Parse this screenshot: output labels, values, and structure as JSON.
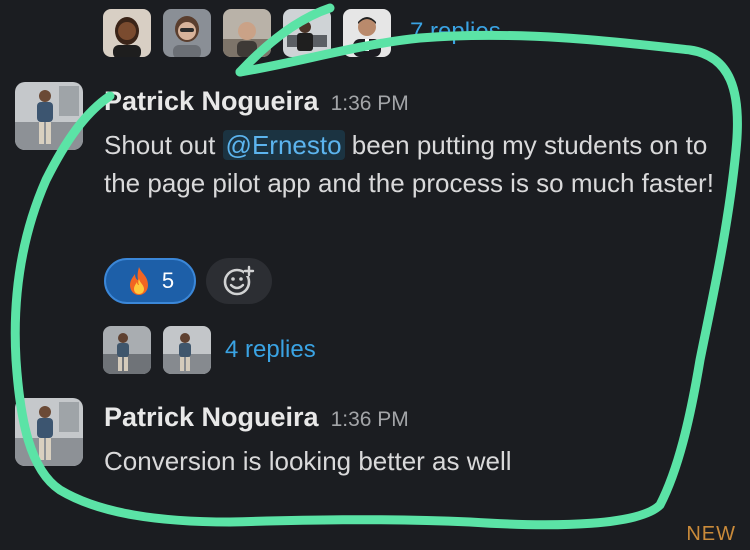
{
  "top_thread": {
    "replies_label": "7 replies"
  },
  "messages": [
    {
      "author": "Patrick Nogueira",
      "time": "1:36 PM",
      "text_before": "Shout out ",
      "mention": "@Ernesto",
      "text_after": " been putting my students on to the page pilot app and the process is so much faster!",
      "reaction": {
        "emoji": "fire-emoji",
        "count": "5"
      },
      "replies_label": "4 replies"
    },
    {
      "author": "Patrick Nogueira",
      "time": "1:36 PM",
      "text": "Conversion is looking better as well"
    }
  ],
  "new_label": "NEW",
  "colors": {
    "background": "#1b1d21",
    "link": "#3aa3e3",
    "mention": "#5cb4ee",
    "reaction_bg": "#1d5fa8",
    "highlight_stroke": "#5be3a6",
    "new_label": "#c98a3a"
  }
}
